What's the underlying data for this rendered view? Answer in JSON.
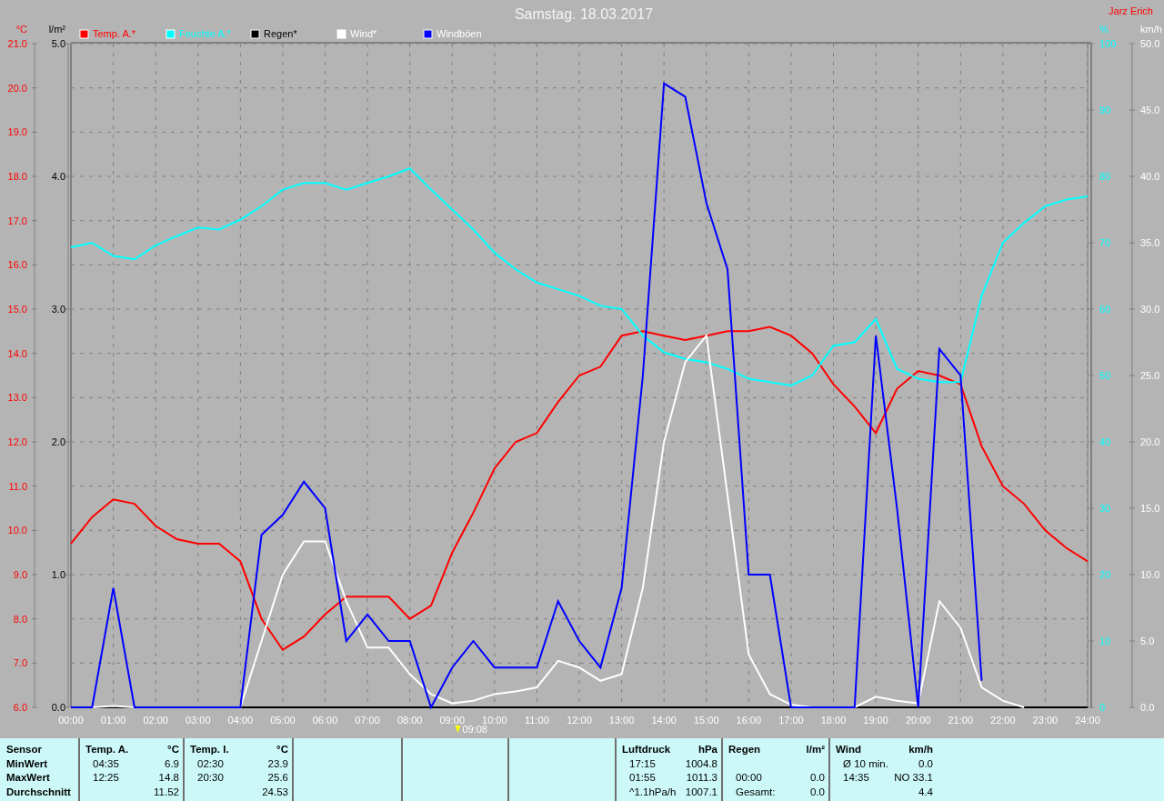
{
  "window": {
    "title": "Samstag. 18.03.2017",
    "user": "Jarz Erich"
  },
  "chart": {
    "chart_data": {
      "type": "line",
      "x": [
        0,
        0.5,
        1,
        1.5,
        2,
        2.5,
        3,
        3.5,
        4,
        4.5,
        5,
        5.5,
        6,
        6.5,
        7,
        7.5,
        8,
        8.5,
        9,
        9.5,
        10,
        10.5,
        11,
        11.5,
        12,
        12.5,
        13,
        13.5,
        14,
        14.5,
        15,
        15.5,
        16,
        16.5,
        17,
        17.5,
        18,
        18.5,
        19,
        19.5,
        20,
        20.5,
        21,
        21.5,
        22,
        22.5,
        23,
        23.5,
        24
      ],
      "xticks": [
        {
          "value": 0,
          "label": "00:00"
        },
        {
          "value": 1,
          "label": "01:00"
        },
        {
          "value": 2,
          "label": "02:00"
        },
        {
          "value": 3,
          "label": "03:00"
        },
        {
          "value": 4,
          "label": "04:00"
        },
        {
          "value": 5,
          "label": "05:00"
        },
        {
          "value": 6,
          "label": "06:00"
        },
        {
          "value": 7,
          "label": "07:00"
        },
        {
          "value": 8,
          "label": "08:00"
        },
        {
          "value": 9,
          "label": "09:00"
        },
        {
          "value": 10,
          "label": "10:00"
        },
        {
          "value": 11,
          "label": "11:00"
        },
        {
          "value": 12,
          "label": "12:00"
        },
        {
          "value": 13,
          "label": "13:00"
        },
        {
          "value": 14,
          "label": "14:00"
        },
        {
          "value": 15,
          "label": "15:00"
        },
        {
          "value": 16,
          "label": "16:00"
        },
        {
          "value": 17,
          "label": "17:00"
        },
        {
          "value": 18,
          "label": "18:00"
        },
        {
          "value": 19,
          "label": "19:00"
        },
        {
          "value": 20,
          "label": "20:00"
        },
        {
          "value": 21,
          "label": "21:00"
        },
        {
          "value": 22,
          "label": "22:00"
        },
        {
          "value": 23,
          "label": "23:00"
        },
        {
          "value": 24,
          "label": "24:00"
        }
      ],
      "xlim": [
        0,
        24
      ],
      "ylabel": "°C",
      "ylim": [
        6,
        21
      ],
      "yticks": [
        {
          "value": 21,
          "label": "21.0"
        },
        {
          "value": 20,
          "label": "20.0"
        },
        {
          "value": 19,
          "label": "19.0"
        },
        {
          "value": 18,
          "label": "18.0"
        },
        {
          "value": 17,
          "label": "17.0"
        },
        {
          "value": 16,
          "label": "16.0"
        },
        {
          "value": 15,
          "label": "15.0"
        },
        {
          "value": 14,
          "label": "14.0"
        },
        {
          "value": 13,
          "label": "13.0"
        },
        {
          "value": 12,
          "label": "12.0"
        },
        {
          "value": 11,
          "label": "11.0"
        },
        {
          "value": 10,
          "label": "10.0"
        },
        {
          "value": 9,
          "label": "9.0"
        },
        {
          "value": 8,
          "label": "8.0"
        },
        {
          "value": 7,
          "label": "7.0"
        },
        {
          "value": 6,
          "label": "6.0"
        }
      ],
      "y2label": "km/h",
      "y2lim": [
        0,
        50
      ],
      "y2ticks": [
        {
          "value": 50,
          "label": "50.0"
        },
        {
          "value": 45,
          "label": "45.0"
        },
        {
          "value": 40,
          "label": "40.0"
        },
        {
          "value": 35,
          "label": "35.0"
        },
        {
          "value": 30,
          "label": "30.0"
        },
        {
          "value": 25,
          "label": "25.0"
        },
        {
          "value": 20,
          "label": "20.0"
        },
        {
          "value": 15,
          "label": "15.0"
        },
        {
          "value": 10,
          "label": "10.0"
        },
        {
          "value": 5,
          "label": "5.0"
        },
        {
          "value": 0,
          "label": "0.0"
        }
      ],
      "y3label": "%",
      "y3lim": [
        0,
        100
      ],
      "y3ticks": [
        100,
        90,
        80,
        70,
        60,
        50,
        40,
        30,
        20,
        10,
        0
      ],
      "series": [
        {
          "name": "Temp. A.*",
          "color": "#ff0000",
          "values": [
            9.7,
            10.3,
            10.7,
            10.6,
            10.1,
            9.8,
            9.7,
            9.7,
            9.3,
            8.0,
            7.3,
            7.6,
            8.1,
            8.5,
            8.5,
            8.5,
            8.0,
            8.3,
            9.5,
            10.4,
            11.4,
            12.0,
            12.2,
            12.9,
            13.5,
            13.7,
            14.4,
            14.5,
            14.4,
            14.3,
            14.4,
            14.5,
            14.5,
            14.6,
            14.4,
            14.0,
            13.3,
            12.8,
            12.2,
            13.2,
            13.6,
            13.5,
            13.3,
            11.9,
            11.0,
            10.6,
            10.0,
            9.6,
            9.3
          ]
        },
        {
          "name": "Feuchte A.*",
          "color": "#00ffff",
          "axis": "y3",
          "values": [
            69.3,
            70,
            68,
            67.5,
            69.6,
            71,
            72.3,
            72,
            73.5,
            75.5,
            78,
            79,
            79,
            78,
            79,
            80,
            81.2,
            78,
            75,
            72,
            68.5,
            66,
            64,
            63,
            62,
            60.5,
            60,
            56,
            53.5,
            52.5,
            52,
            51,
            49.5,
            49,
            48.5,
            50,
            54.5,
            55,
            58.5,
            51,
            49.5,
            49,
            49,
            62,
            70,
            73,
            75.5,
            76.5,
            77
          ]
        },
        {
          "name": "Regen*",
          "color": "#000000",
          "axis": "y2",
          "values": [
            0,
            0,
            0,
            0,
            0,
            0,
            0,
            0,
            0,
            0,
            0,
            0,
            0,
            0,
            0,
            0,
            0,
            0,
            0,
            0,
            0,
            0,
            0,
            0,
            0,
            0,
            0,
            0,
            0,
            0,
            0,
            0,
            0,
            0,
            0,
            0,
            0,
            0,
            0,
            0,
            0,
            0,
            0,
            0,
            0,
            0,
            0,
            0,
            0
          ]
        },
        {
          "name": "Wind*",
          "color": "#ffffff",
          "axis": "y2",
          "values": [
            0,
            0,
            0.1,
            0,
            0,
            0,
            0,
            0,
            0,
            5,
            10,
            12.5,
            12.5,
            8,
            4.5,
            4.5,
            2.5,
            1,
            0.3,
            0.5,
            1,
            1.2,
            1.5,
            3.5,
            3,
            2,
            2.5,
            9,
            20,
            26,
            28,
            16,
            4,
            1,
            0.2,
            0,
            0,
            0,
            0.8,
            0.5,
            0.3,
            8,
            6,
            1.5,
            0.5,
            0,
            null,
            null,
            null
          ]
        },
        {
          "name": "Windböen",
          "color": "#0000ff",
          "axis": "y2",
          "values": [
            0,
            0,
            9,
            0,
            0,
            0,
            0,
            0,
            0,
            13,
            14.5,
            17,
            15,
            5,
            7,
            5,
            5,
            0,
            3,
            5,
            3,
            3,
            3,
            8,
            5,
            3,
            9,
            25,
            47,
            46,
            38,
            33,
            10,
            10,
            0,
            0,
            0,
            0,
            28,
            15,
            0,
            27,
            25,
            2,
            null,
            null,
            null,
            null,
            null
          ]
        }
      ],
      "grid": true,
      "legend": true,
      "annotations": [
        "09:08"
      ]
    },
    "rain_axis": {
      "label": "l/m²",
      "ticks": [
        "5.0",
        "4.0",
        "3.0",
        "2.0",
        "1.0",
        "0.0"
      ]
    }
  },
  "stats": {
    "row_labels": [
      "Sensor",
      "MinWert",
      "MaxWert",
      "Durchschnitt"
    ],
    "columns": [
      {
        "kind": "sensor",
        "header": "Temp. A.",
        "unit": "°C",
        "rows": [
          {
            "time": "04:35",
            "value": "6.9"
          },
          {
            "time": "12:25",
            "value": "14.8"
          },
          {
            "value": "11.52"
          }
        ]
      },
      {
        "kind": "sensor",
        "header": "Temp. I.",
        "unit": "°C",
        "rows": [
          {
            "time": "02:30",
            "value": "23.9"
          },
          {
            "time": "20:30",
            "value": "25.6"
          },
          {
            "value": "24.53"
          }
        ]
      },
      {
        "kind": "empty"
      },
      {
        "kind": "empty"
      },
      {
        "kind": "empty"
      },
      {
        "kind": "sensor",
        "header": "Luftdruck",
        "unit": "hPa",
        "rows": [
          {
            "time": "17:15",
            "value": "1004.8"
          },
          {
            "time": "01:55",
            "value": "1011.3"
          },
          {
            "time": "^1.1hPa/h",
            "value": "1007.1"
          }
        ]
      },
      {
        "kind": "sensor",
        "header": "Regen",
        "unit": "l/m²",
        "rows": [
          {},
          {
            "time": "00:00",
            "value": "0.0"
          },
          {
            "time": "Gesamt:",
            "value": "0.0"
          }
        ]
      },
      {
        "kind": "sensor",
        "header": "Wind",
        "unit": "km/h",
        "rows": [
          {
            "time": "Ø 10 min.",
            "value": "0.0"
          },
          {
            "time": "14:35",
            "value": "NO 33.1"
          },
          {
            "value": "4.4"
          }
        ]
      }
    ]
  }
}
